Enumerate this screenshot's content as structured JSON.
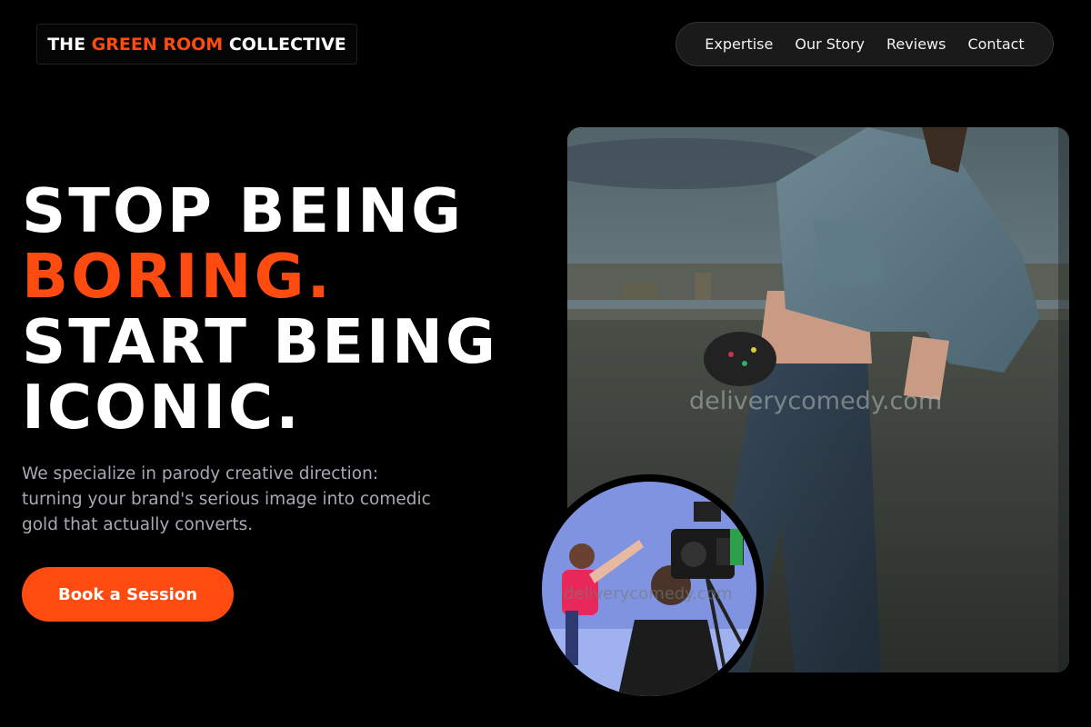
{
  "brand": {
    "part1": "THE ",
    "accent": "GREEN ROOM",
    "part2": " COLLECTIVE"
  },
  "nav": {
    "items": [
      "Expertise",
      "Our Story",
      "Reviews",
      "Contact"
    ]
  },
  "hero": {
    "line1": "STOP BEING",
    "line2": "BORING.",
    "line3": "START BEING",
    "line4": "ICONIC.",
    "subtext": "We specialize in parody creative direction: turning your brand's serious image into comedic gold that actually converts.",
    "cta_label": "Book a Session"
  },
  "watermarks": {
    "main": "deliverycomedy.com",
    "inset": "deliverycomedy.com"
  },
  "colors": {
    "accent": "#ff4b0f",
    "background": "#000000",
    "nav_bg": "#1a1a1a",
    "subtext": "#a9a9b3"
  }
}
